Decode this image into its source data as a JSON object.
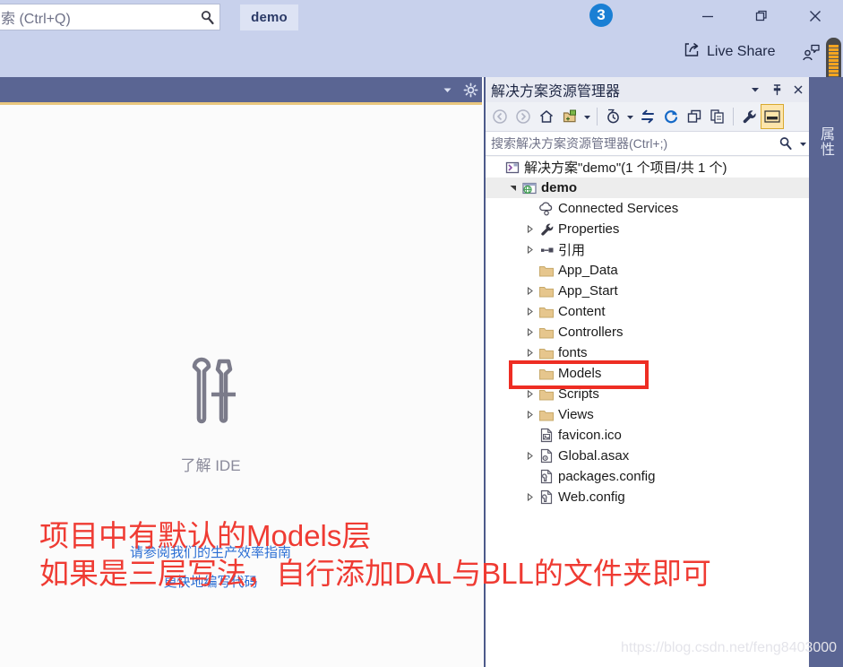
{
  "titlebar": {
    "quick_launch_value": "索 (Ctrl+Q)",
    "quick_launch_icon": "search-icon",
    "solution_chip_label": "demo",
    "notification_count": "3",
    "minimize_label": "—",
    "restore_label": "❐",
    "close_label": "✕",
    "live_share_label": "Live Share",
    "live_share_icon": "share-arrow-icon",
    "feedback_icon": "send-feedback-icon"
  },
  "editor": {
    "dropdown_icon": "chevron-down-icon",
    "settings_icon": "gear-icon",
    "ide_icon": "wrench-screwdriver-icon",
    "ide_label": "了解 IDE",
    "link_1": "请参阅我们的生产效率指南",
    "link_2": "更快地编写代码"
  },
  "solution_explorer": {
    "title": "解决方案资源管理器",
    "window_dropdown_icon": "chevron-down-icon",
    "pin_icon": "pin-icon",
    "close_icon": "close-icon",
    "toolbar": [
      {
        "name": "back-button",
        "icon": "arrow-left-circle-icon",
        "state": "disabled"
      },
      {
        "name": "forward-button",
        "icon": "arrow-right-circle-icon",
        "state": "disabled"
      },
      {
        "name": "home-button",
        "icon": "home-icon",
        "state": "enabled"
      },
      {
        "name": "new-folder-button",
        "icon": "new-folder-icon",
        "state": "enabled"
      },
      {
        "name": "new-folder-dropdown",
        "icon": "chevron-down-icon",
        "state": "enabled"
      },
      {
        "name": "pending-changes-filter-button",
        "icon": "clock-filter-icon",
        "state": "enabled"
      },
      {
        "name": "pending-changes-dropdown",
        "icon": "chevron-down-icon",
        "state": "enabled"
      },
      {
        "name": "sync-with-active-document-button",
        "icon": "sync-arrows-icon",
        "state": "enabled"
      },
      {
        "name": "refresh-button",
        "icon": "refresh-icon",
        "state": "enabled"
      },
      {
        "name": "collapse-all-button",
        "icon": "collapse-all-icon",
        "state": "enabled"
      },
      {
        "name": "show-all-files-button",
        "icon": "show-all-files-icon",
        "state": "enabled"
      },
      {
        "name": "properties-button",
        "icon": "wrench-icon",
        "state": "enabled"
      },
      {
        "name": "preview-pane-button",
        "icon": "preview-pane-icon",
        "state": "active"
      }
    ],
    "search_placeholder": "搜索解决方案资源管理器(Ctrl+;)",
    "search_icon": "search-icon",
    "search_dropdown_icon": "chevron-down-icon",
    "tree": [
      {
        "label": "解决方案\"demo\"(1 个项目/共 1 个)",
        "icon": "solution-icon",
        "indent": 0,
        "expander": "none",
        "bold": false,
        "selected": false
      },
      {
        "label": "demo",
        "icon": "web-project-icon",
        "indent": 1,
        "expander": "expanded",
        "bold": true,
        "selected": true
      },
      {
        "label": "Connected Services",
        "icon": "connected-services-icon",
        "indent": 2,
        "expander": "none",
        "bold": false,
        "selected": false
      },
      {
        "label": "Properties",
        "icon": "wrench-icon",
        "indent": 2,
        "expander": "collapsed",
        "bold": false,
        "selected": false
      },
      {
        "label": "引用",
        "icon": "references-icon",
        "indent": 2,
        "expander": "collapsed",
        "bold": false,
        "selected": false
      },
      {
        "label": "App_Data",
        "icon": "folder-icon",
        "indent": 2,
        "expander": "none",
        "bold": false,
        "selected": false
      },
      {
        "label": "App_Start",
        "icon": "folder-icon",
        "indent": 2,
        "expander": "collapsed",
        "bold": false,
        "selected": false
      },
      {
        "label": "Content",
        "icon": "folder-icon",
        "indent": 2,
        "expander": "collapsed",
        "bold": false,
        "selected": false
      },
      {
        "label": "Controllers",
        "icon": "folder-icon",
        "indent": 2,
        "expander": "collapsed",
        "bold": false,
        "selected": false
      },
      {
        "label": "fonts",
        "icon": "folder-icon",
        "indent": 2,
        "expander": "collapsed",
        "bold": false,
        "selected": false
      },
      {
        "label": "Models",
        "icon": "folder-icon",
        "indent": 2,
        "expander": "none",
        "bold": false,
        "selected": false
      },
      {
        "label": "Scripts",
        "icon": "folder-icon",
        "indent": 2,
        "expander": "collapsed",
        "bold": false,
        "selected": false
      },
      {
        "label": "Views",
        "icon": "folder-icon",
        "indent": 2,
        "expander": "collapsed",
        "bold": false,
        "selected": false
      },
      {
        "label": "favicon.ico",
        "icon": "image-file-icon",
        "indent": 2,
        "expander": "none",
        "bold": false,
        "selected": false
      },
      {
        "label": "Global.asax",
        "icon": "asax-file-icon",
        "indent": 2,
        "expander": "collapsed",
        "bold": false,
        "selected": false
      },
      {
        "label": "packages.config",
        "icon": "config-file-icon",
        "indent": 2,
        "expander": "none",
        "bold": false,
        "selected": false
      },
      {
        "label": "Web.config",
        "icon": "config-file-icon",
        "indent": 2,
        "expander": "collapsed",
        "bold": false,
        "selected": false
      }
    ]
  },
  "properties_tab": {
    "label": "属性"
  },
  "annotation": {
    "line_1": "项目中有默认的Models层",
    "line_2": "如果是三层写法，自行添加DAL与BLL的文件夹即可",
    "highlight_target": "Models",
    "color": "#ef3b33"
  },
  "watermark": {
    "text": "https://blog.csdn.net/feng8403000"
  }
}
